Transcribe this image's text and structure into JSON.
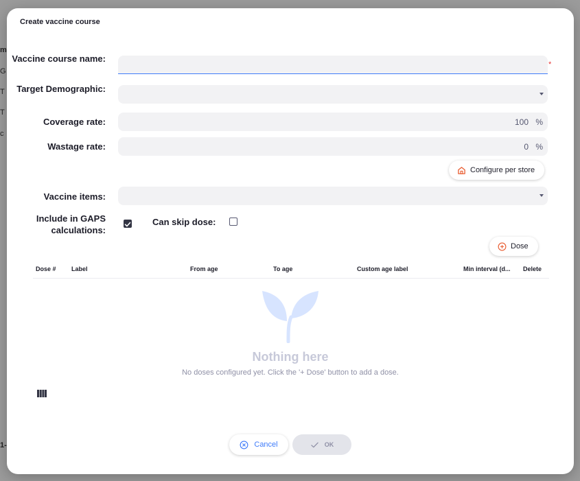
{
  "background": {
    "fragments": [
      "me",
      "G",
      "T",
      "T",
      "c",
      "1-"
    ]
  },
  "modal": {
    "title": "Create vaccine course",
    "fields": {
      "name_label": "Vaccine course name:",
      "name_value": "",
      "demographic_label": "Target Demographic:",
      "demographic_value": "",
      "coverage_label": "Coverage rate:",
      "coverage_value": "100",
      "coverage_unit": "%",
      "wastage_label": "Wastage rate:",
      "wastage_value": "0",
      "wastage_unit": "%",
      "items_label": "Vaccine items:",
      "items_value": "",
      "gaps_label": "Include in GAPS calculations:",
      "gaps_checked": true,
      "skip_label": "Can skip dose:",
      "skip_checked": false
    },
    "configure_label": "Configure per store",
    "add_dose_label": "Dose",
    "table": {
      "columns": [
        "Dose #",
        "Label",
        "From age",
        "To age",
        "Custom age label",
        "Min interval (d...",
        "Delete"
      ]
    },
    "empty": {
      "title": "Nothing here",
      "message": "No doses configured yet. Click the '+ Dose' button to add a dose."
    },
    "footer": {
      "cancel_label": "Cancel",
      "ok_label": "OK"
    },
    "colors": {
      "accent": "#3e7bfa",
      "required": "#e53535",
      "store_icon": "#e95c30",
      "empty_illustration": "#d7e4ff"
    }
  }
}
